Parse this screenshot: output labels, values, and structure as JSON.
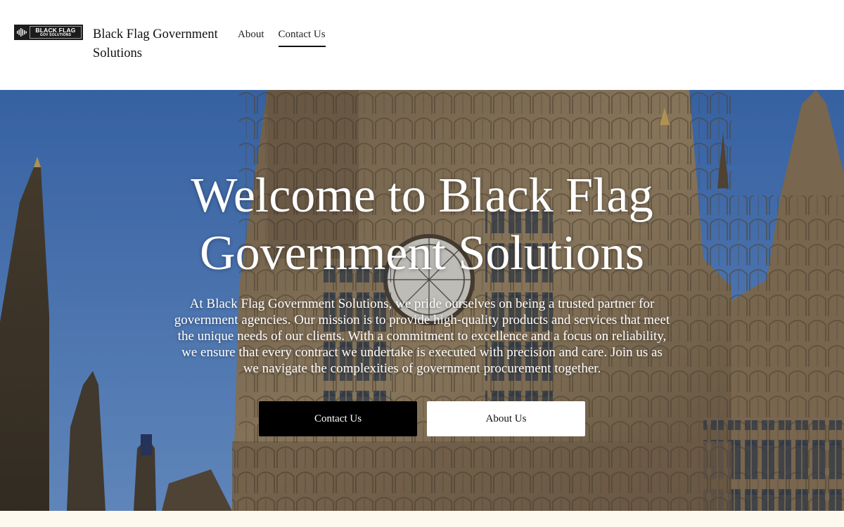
{
  "header": {
    "logo": {
      "line1": "BLACK FLAG",
      "line2": "GOV SOLUTIONS"
    },
    "site_title": "Black Flag Government Solutions",
    "nav": [
      {
        "label": "About",
        "active": false
      },
      {
        "label": "Contact Us",
        "active": true
      }
    ]
  },
  "hero": {
    "title": "Welcome to Black Flag Government Solutions",
    "description": "At Black Flag Government Solutions, we pride ourselves on being a trusted partner for government agencies. Our mission is to provide high-quality products and services that meet the unique needs of our clients. With a commitment to excellence and a focus on reliability, we ensure that every contract we undertake is executed with precision and care. Join us as we navigate the complexities of government procurement together.",
    "primary_button": "Contact Us",
    "secondary_button": "About Us"
  },
  "colors": {
    "header_bg": "#ffffff",
    "primary_button_bg": "#000000",
    "secondary_button_bg": "#ffffff",
    "page_bg": "#fdfaf2",
    "sky": "#4f7fc4",
    "stone": "#8f7a5e"
  }
}
